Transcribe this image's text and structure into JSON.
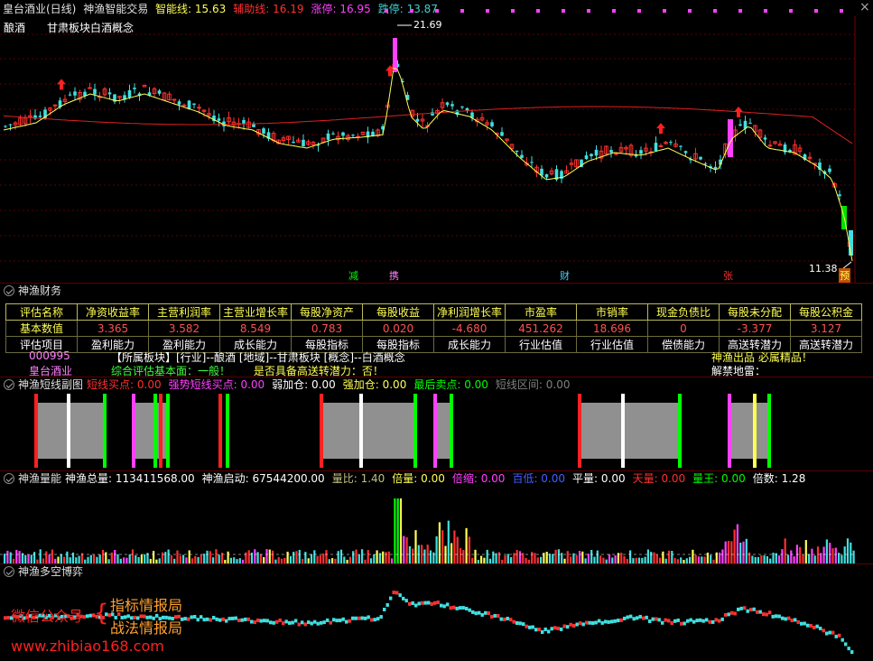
{
  "header": {
    "title": "皇台酒业(日线)",
    "indicator_name": "神渔智能交易",
    "items": [
      {
        "label": "智能线: ",
        "value": "15.63",
        "color": "#ffff54"
      },
      {
        "label": "辅助线: ",
        "value": "16.19",
        "color": "#ff3030"
      },
      {
        "label": "涨停: ",
        "value": "16.95",
        "color": "#ff40ff"
      },
      {
        "label": "跌停: ",
        "value": "13.87",
        "color": "#40d0d0"
      }
    ]
  },
  "main": {
    "sector": "酿酒",
    "concept": "甘肃板块白酒概念",
    "high_label": "21.69",
    "low_label": "11.38",
    "signals": [
      {
        "text": "减",
        "color": "#00ff00"
      },
      {
        "text": "携",
        "color": "#ff80ff"
      },
      {
        "text": "财",
        "color": "#40d0ff"
      },
      {
        "text": "张",
        "color": "#ff3030"
      },
      {
        "text": "预",
        "color": "#ffff54"
      }
    ]
  },
  "finance": {
    "title": "神渔财务",
    "headers": [
      "评估名称",
      "净资收益率",
      "主营利润率",
      "主营业增长率",
      "每股净资产",
      "每股收益",
      "净利润增长率",
      "市盈率",
      "市销率",
      "现金负债比",
      "每股未分配",
      "每股公积金"
    ],
    "values_label": "基本数值",
    "values": [
      "3.365",
      "3.582",
      "8.549",
      "0.783",
      "0.020",
      "-4.680",
      "451.262",
      "18.696",
      "0",
      "-3.377",
      "3.127"
    ],
    "items": [
      "评估项目",
      "盈利能力",
      "盈利能力",
      "成长能力",
      "每股指标",
      "每股指标",
      "成长能力",
      "行业估值",
      "行业估值",
      "偿债能力",
      "高送转潜力",
      "高送转潜力"
    ],
    "code": "000995",
    "name": "皇台酒业",
    "board_info": "【所属板块】[行业]--酿酒 [地域]--甘肃板块 [概念]--白酒概念",
    "eval_label": "综合评估基本面：",
    "eval_value": "一般！",
    "transfer_label": "是否具备高送转潜力：",
    "transfer_value": "否！",
    "brand": "神渔出品 必属精品！",
    "mine": "解禁地雷："
  },
  "short": {
    "title": "神渔短线副图",
    "items": [
      {
        "label": "短线买点: ",
        "value": "0.00",
        "color": "#ff3030"
      },
      {
        "label": "强势短线买点: ",
        "value": "0.00",
        "color": "#ff40ff"
      },
      {
        "label": "弱加仓: ",
        "value": "0.00",
        "color": "#ffffff"
      },
      {
        "label": "强加仓: ",
        "value": "0.00",
        "color": "#ffff54"
      },
      {
        "label": "最后卖点: ",
        "value": "0.00",
        "color": "#00ff00"
      },
      {
        "label": "短线区间: ",
        "value": "0.00",
        "color": "#808080"
      }
    ]
  },
  "volume": {
    "title": "神渔量能",
    "items": [
      {
        "label": "神渔总量: ",
        "value": "113411568.00",
        "color": "#ffffff"
      },
      {
        "label": "神渔启动: ",
        "value": "67544200.00",
        "color": "#ffffff"
      },
      {
        "label": "量比: ",
        "value": "1.40",
        "color": "#c0c080"
      },
      {
        "label": "倍量: ",
        "value": "0.00",
        "color": "#ffff54"
      },
      {
        "label": "倍缩: ",
        "value": "0.00",
        "color": "#ff40ff"
      },
      {
        "label": "百低: ",
        "value": "0.00",
        "color": "#4060ff"
      },
      {
        "label": "平量: ",
        "value": "0.00",
        "color": "#ffffff"
      },
      {
        "label": "天量: ",
        "value": "0.00",
        "color": "#ff3030"
      },
      {
        "label": "量王: ",
        "value": "0.00",
        "color": "#00ff00"
      },
      {
        "label": "倍数: ",
        "value": "1.28",
        "color": "#ffffff"
      }
    ]
  },
  "duokong": {
    "title": "神渔多空博弈"
  },
  "watermark": {
    "wechat": "微信公众号",
    "line1": "指标情报局",
    "line2": "战法情报局",
    "url": "www.zhibiao168.com"
  }
}
